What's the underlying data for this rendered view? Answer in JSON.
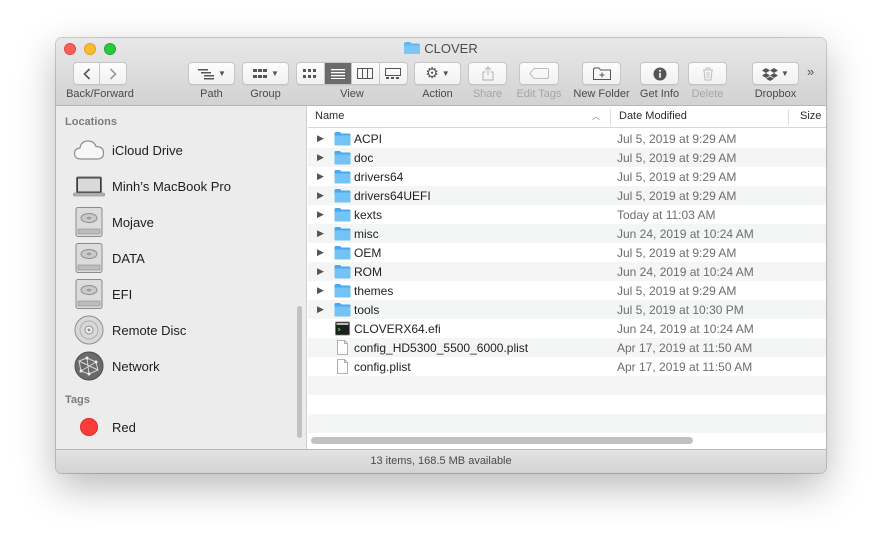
{
  "window": {
    "title": "CLOVER",
    "status": "13 items, 168.5 MB available"
  },
  "toolbar": {
    "back_forward_label": "Back/Forward",
    "path_label": "Path",
    "group_label": "Group",
    "view_label": "View",
    "action_label": "Action",
    "share_label": "Share",
    "edit_tags_label": "Edit Tags",
    "new_folder_label": "New Folder",
    "get_info_label": "Get Info",
    "delete_label": "Delete",
    "dropbox_label": "Dropbox",
    "more_glyph": "»"
  },
  "sidebar": {
    "locations_header": "Locations",
    "locations": [
      {
        "label": "iCloud Drive",
        "icon": "cloud-icon"
      },
      {
        "label": "Minh’s MacBook Pro",
        "icon": "laptop-icon"
      },
      {
        "label": "Mojave",
        "icon": "hard-disk-icon"
      },
      {
        "label": "DATA",
        "icon": "hard-disk-icon"
      },
      {
        "label": "EFI",
        "icon": "hard-disk-icon"
      },
      {
        "label": "Remote Disc",
        "icon": "optical-disc-icon"
      },
      {
        "label": "Network",
        "icon": "network-globe-icon"
      }
    ],
    "tags_header": "Tags",
    "tags": [
      {
        "label": "Red",
        "color": "#fc3d39"
      }
    ]
  },
  "columns": {
    "name": "Name",
    "date_modified": "Date Modified",
    "size": "Size"
  },
  "files": [
    {
      "name": "ACPI",
      "date": "Jul 5, 2019 at 9:29 AM",
      "kind": "folder"
    },
    {
      "name": "doc",
      "date": "Jul 5, 2019 at 9:29 AM",
      "kind": "folder"
    },
    {
      "name": "drivers64",
      "date": "Jul 5, 2019 at 9:29 AM",
      "kind": "folder"
    },
    {
      "name": "drivers64UEFI",
      "date": "Jul 5, 2019 at 9:29 AM",
      "kind": "folder"
    },
    {
      "name": "kexts",
      "date": "Today at 11:03 AM",
      "kind": "folder"
    },
    {
      "name": "misc",
      "date": "Jun 24, 2019 at 10:24 AM",
      "kind": "folder"
    },
    {
      "name": "OEM",
      "date": "Jul 5, 2019 at 9:29 AM",
      "kind": "folder"
    },
    {
      "name": "ROM",
      "date": "Jun 24, 2019 at 10:24 AM",
      "kind": "folder"
    },
    {
      "name": "themes",
      "date": "Jul 5, 2019 at 9:29 AM",
      "kind": "folder"
    },
    {
      "name": "tools",
      "date": "Jul 5, 2019 at 10:30 PM",
      "kind": "folder"
    },
    {
      "name": "CLOVERX64.efi",
      "date": "Jun 24, 2019 at 10:24 AM",
      "kind": "executable"
    },
    {
      "name": "config_HD5300_5500_6000.plist",
      "date": "Apr 17, 2019 at 11:50 AM",
      "kind": "document"
    },
    {
      "name": "config.plist",
      "date": "Apr 17, 2019 at 11:50 AM",
      "kind": "document"
    }
  ],
  "colors": {
    "folder_blue": "#5bb8f5",
    "selection_gray": "#6b6b6b",
    "tag_red": "#fc3d39"
  }
}
